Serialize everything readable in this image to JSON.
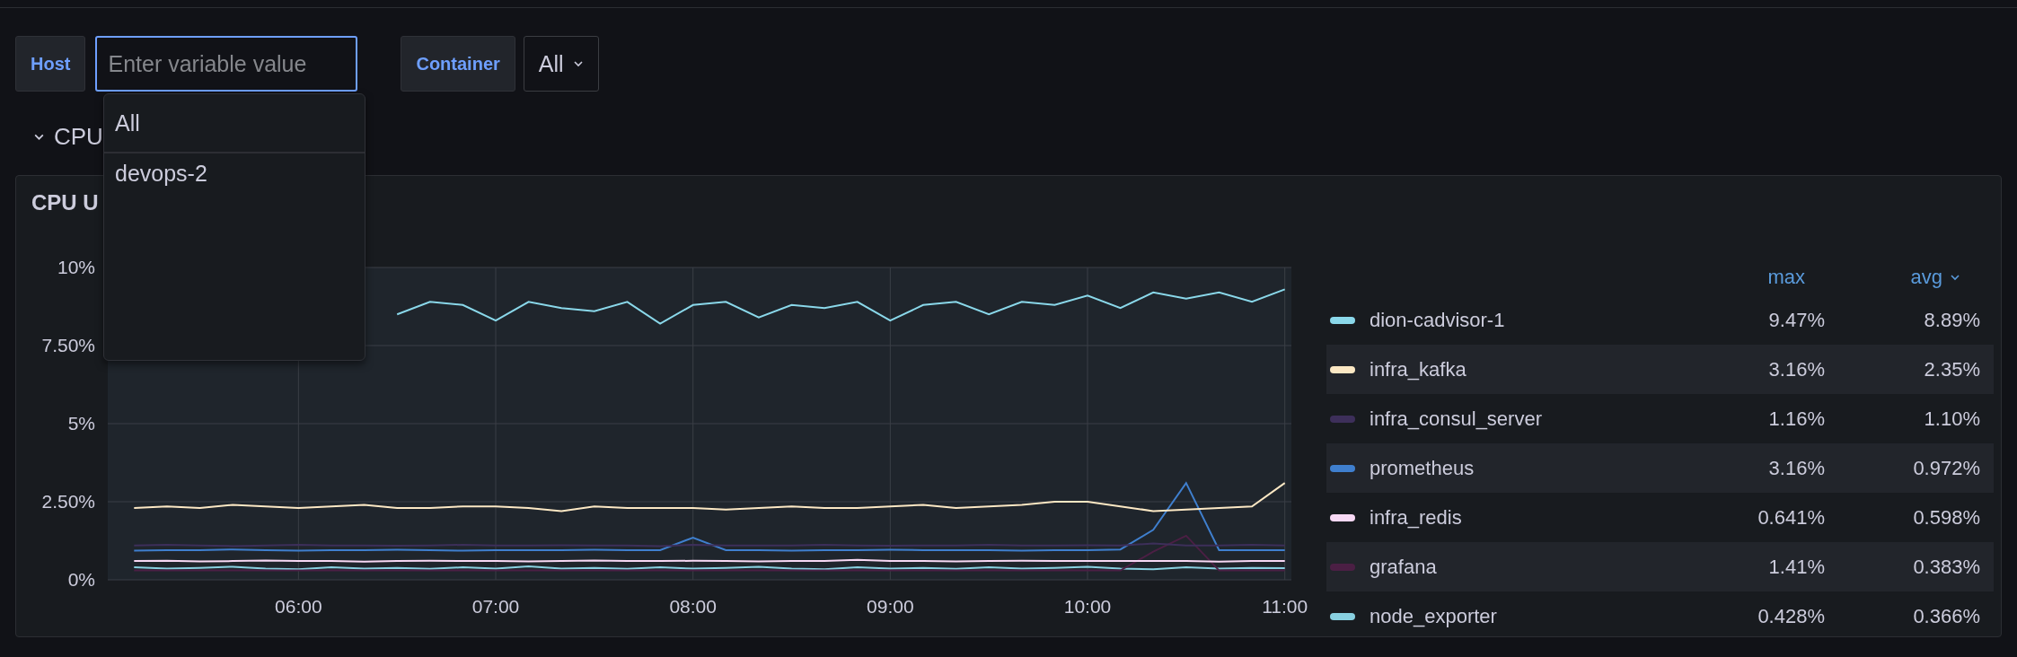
{
  "variables": [
    {
      "label": "Host",
      "kind": "input",
      "placeholder": "Enter variable value",
      "open": true,
      "options": [
        {
          "label": "All"
        },
        {
          "label": "devops-2"
        }
      ]
    },
    {
      "label": "Container",
      "kind": "select",
      "value": "All"
    }
  ],
  "section": {
    "title": "CPU",
    "expanded": true
  },
  "panel": {
    "title": "CPU U",
    "chart_data": {
      "type": "line",
      "grid": true,
      "x": [
        310,
        320,
        330,
        340,
        350,
        360,
        370,
        380,
        390,
        400,
        410,
        420,
        430,
        440,
        450,
        460,
        470,
        480,
        490,
        500,
        510,
        520,
        530,
        540,
        550,
        560,
        570,
        580,
        590,
        600,
        610,
        620,
        630,
        640,
        650,
        660
      ],
      "xlim": [
        302,
        662
      ],
      "ylim": [
        0,
        10
      ],
      "xticks": [
        {
          "value": 360,
          "label": "06:00"
        },
        {
          "value": 420,
          "label": "07:00"
        },
        {
          "value": 480,
          "label": "08:00"
        },
        {
          "value": 540,
          "label": "09:00"
        },
        {
          "value": 600,
          "label": "10:00"
        },
        {
          "value": 660,
          "label": "11:00"
        }
      ],
      "yticks": [
        {
          "value": 0,
          "label": "0%"
        },
        {
          "value": 2.5,
          "label": "2.50%"
        },
        {
          "value": 5,
          "label": "5%"
        },
        {
          "value": 7.5,
          "label": "7.50%"
        },
        {
          "value": 10,
          "label": "10%"
        }
      ],
      "series": [
        {
          "name": "dion-cadvisor-1",
          "color": "#8ad8ea",
          "values": [
            null,
            null,
            null,
            null,
            null,
            null,
            null,
            null,
            8.5,
            8.9,
            8.8,
            8.3,
            8.9,
            8.7,
            8.6,
            8.9,
            8.2,
            8.8,
            8.9,
            8.4,
            8.8,
            8.7,
            8.9,
            8.3,
            8.8,
            8.9,
            8.5,
            8.9,
            8.8,
            9.1,
            8.7,
            9.2,
            9.0,
            9.2,
            8.9,
            9.3
          ]
        },
        {
          "name": "infra_kafka",
          "color": "#fce8c4",
          "values": [
            2.3,
            2.35,
            2.3,
            2.4,
            2.35,
            2.3,
            2.35,
            2.4,
            2.3,
            2.3,
            2.35,
            2.35,
            2.3,
            2.2,
            2.35,
            2.3,
            2.3,
            2.3,
            2.25,
            2.3,
            2.35,
            2.3,
            2.3,
            2.35,
            2.4,
            2.3,
            2.35,
            2.4,
            2.5,
            2.5,
            2.35,
            2.2,
            2.25,
            2.3,
            2.35,
            3.1
          ]
        },
        {
          "name": "infra_consul_server",
          "color": "#3d2f5a",
          "values": [
            1.1,
            1.12,
            1.1,
            1.08,
            1.1,
            1.12,
            1.1,
            1.1,
            1.09,
            1.1,
            1.12,
            1.1,
            1.1,
            1.11,
            1.1,
            1.1,
            1.08,
            1.12,
            1.1,
            1.1,
            1.1,
            1.12,
            1.1,
            1.09,
            1.1,
            1.1,
            1.12,
            1.1,
            1.1,
            1.11,
            1.1,
            1.16,
            1.1,
            1.1,
            1.12,
            1.1
          ]
        },
        {
          "name": "prometheus",
          "color": "#3f7fce",
          "values": [
            0.93,
            0.95,
            0.95,
            0.97,
            0.95,
            0.93,
            0.95,
            0.95,
            0.96,
            0.95,
            0.93,
            0.95,
            0.95,
            0.95,
            0.96,
            0.95,
            0.95,
            1.35,
            0.95,
            0.95,
            0.93,
            0.95,
            0.95,
            0.96,
            0.95,
            0.95,
            0.95,
            0.93,
            0.95,
            0.95,
            0.97,
            1.6,
            3.1,
            0.95,
            0.95,
            0.95
          ]
        },
        {
          "name": "infra_redis",
          "color": "#f8d9f5",
          "values": [
            0.6,
            0.61,
            0.59,
            0.6,
            0.62,
            0.6,
            0.6,
            0.58,
            0.6,
            0.61,
            0.6,
            0.6,
            0.59,
            0.6,
            0.62,
            0.6,
            0.6,
            0.61,
            0.6,
            0.59,
            0.6,
            0.6,
            0.64,
            0.6,
            0.6,
            0.59,
            0.6,
            0.61,
            0.6,
            0.6,
            0.6,
            0.6,
            0.6,
            0.58,
            0.6,
            0.6
          ]
        },
        {
          "name": "grafana",
          "color": "#4b1f44",
          "values": [
            0.3,
            0.3,
            0.3,
            0.3,
            0.3,
            0.3,
            0.3,
            0.3,
            0.3,
            0.3,
            0.3,
            0.3,
            0.3,
            0.3,
            0.3,
            0.3,
            0.3,
            0.3,
            0.3,
            0.3,
            0.3,
            0.3,
            0.3,
            0.3,
            0.3,
            0.3,
            0.3,
            0.3,
            0.3,
            0.3,
            0.3,
            0.9,
            1.41,
            0.3,
            0.3,
            0.3
          ]
        },
        {
          "name": "node_exporter",
          "color": "#88d0e0",
          "values": [
            0.4,
            0.36,
            0.38,
            0.42,
            0.36,
            0.34,
            0.4,
            0.36,
            0.38,
            0.35,
            0.4,
            0.36,
            0.43,
            0.36,
            0.38,
            0.35,
            0.4,
            0.36,
            0.38,
            0.42,
            0.36,
            0.34,
            0.4,
            0.36,
            0.38,
            0.35,
            0.4,
            0.36,
            0.38,
            0.42,
            0.36,
            0.34,
            0.4,
            0.36,
            0.38,
            0.37
          ]
        }
      ]
    },
    "legend": {
      "columns": [
        {
          "label": "max",
          "sorted": false
        },
        {
          "label": "avg",
          "sorted": true
        }
      ],
      "items": [
        {
          "max": "9.47%",
          "avg": "8.89%"
        },
        {
          "max": "3.16%",
          "avg": "2.35%"
        },
        {
          "max": "1.16%",
          "avg": "1.10%"
        },
        {
          "max": "3.16%",
          "avg": "0.972%"
        },
        {
          "max": "0.641%",
          "avg": "0.598%"
        },
        {
          "max": "1.41%",
          "avg": "0.383%"
        },
        {
          "max": "0.428%",
          "avg": "0.366%"
        }
      ]
    }
  }
}
